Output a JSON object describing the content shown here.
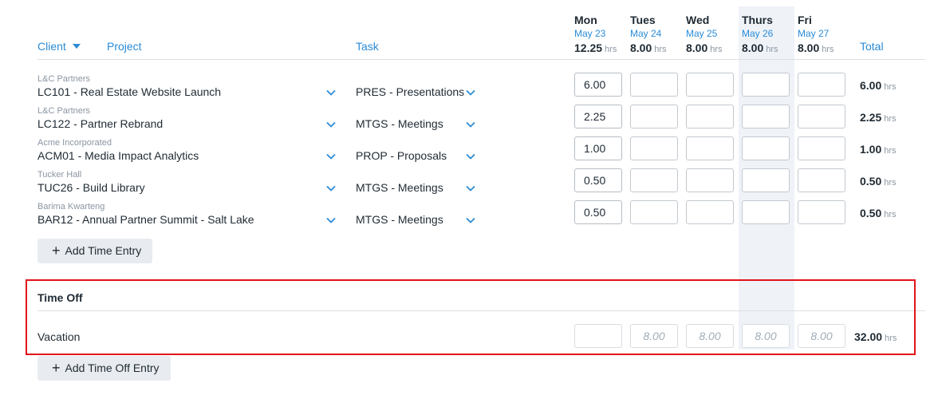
{
  "header": {
    "client_label": "Client",
    "project_label": "Project",
    "task_label": "Task",
    "total_label": "Total"
  },
  "days": [
    {
      "name": "Mon",
      "date": "May 23",
      "total": "12.25",
      "unit": "hrs"
    },
    {
      "name": "Tues",
      "date": "May 24",
      "total": "8.00",
      "unit": "hrs"
    },
    {
      "name": "Wed",
      "date": "May 25",
      "total": "8.00",
      "unit": "hrs"
    },
    {
      "name": "Thurs",
      "date": "May 26",
      "total": "8.00",
      "unit": "hrs"
    },
    {
      "name": "Fri",
      "date": "May 27",
      "total": "8.00",
      "unit": "hrs"
    }
  ],
  "entries": [
    {
      "client": "L&C Partners",
      "project": "LC101 - Real Estate Website Launch",
      "task": "PRES - Presentations",
      "mon": "6.00",
      "total": "6.00",
      "unit": "hrs"
    },
    {
      "client": "L&C Partners",
      "project": "LC122 - Partner Rebrand",
      "task": "MTGS - Meetings",
      "mon": "2.25",
      "total": "2.25",
      "unit": "hrs"
    },
    {
      "client": "Acme Incorporated",
      "project": "ACM01 - Media Impact Analytics",
      "task": "PROP - Proposals",
      "mon": "1.00",
      "total": "1.00",
      "unit": "hrs"
    },
    {
      "client": "Tucker Hall",
      "project": "TUC26 - Build Library",
      "task": "MTGS - Meetings",
      "mon": "0.50",
      "total": "0.50",
      "unit": "hrs"
    },
    {
      "client": "Barima Kwarteng",
      "project": "BAR12 - Annual Partner Summit - Salt Lake",
      "task": "MTGS - Meetings",
      "mon": "0.50",
      "total": "0.50",
      "unit": "hrs"
    }
  ],
  "add_time_entry_label": "Add Time Entry",
  "time_off": {
    "title": "Time Off",
    "row_label": "Vacation",
    "placeholders": [
      "8.00",
      "8.00",
      "8.00",
      "8.00"
    ],
    "total": "32.00",
    "unit": "hrs"
  },
  "add_time_off_label": "Add Time Off Entry",
  "colors": {
    "accent": "#2a8bd6",
    "highlight_border": "#e3121b",
    "today_column": "#eff3f8"
  }
}
